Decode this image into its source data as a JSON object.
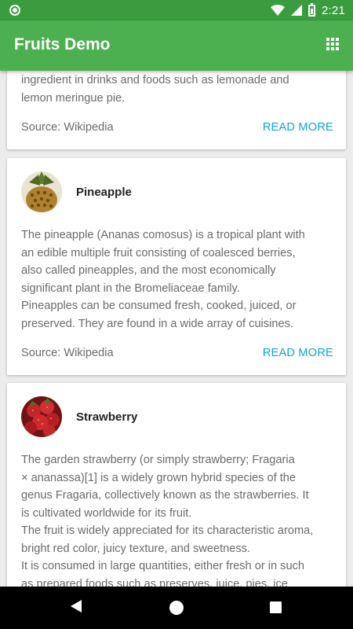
{
  "status_bar": {
    "time": "2:21"
  },
  "app_bar": {
    "title": "Fruits Demo"
  },
  "cards": [
    {
      "description_lines": [
        "ingredient in drinks and foods such as lemonade and",
        "lemon meringue pie."
      ],
      "source": "Source: Wikipedia",
      "read_more": "READ MORE"
    },
    {
      "name": "Pineapple",
      "description_lines": [
        "The pineapple (Ananas comosus) is a tropical plant with",
        "an edible multiple fruit consisting of coalesced berries,",
        "also called pineapples, and the most economically",
        "significant plant in the Bromeliaceae family.",
        "Pineapples can be consumed fresh, cooked, juiced, or",
        "preserved. They are found in a wide array of cuisines."
      ],
      "source": "Source: Wikipedia",
      "read_more": "READ MORE"
    },
    {
      "name": "Strawberry",
      "description_lines": [
        "The garden strawberry (or simply strawberry; Fragaria",
        "× ananassa)[1] is a widely grown hybrid species of the",
        "genus Fragaria, collectively known as the strawberries. It",
        "is cultivated worldwide for its fruit.",
        "The fruit is widely appreciated for its characteristic aroma,",
        "bright red color, juicy texture, and sweetness.",
        "It is consumed in large quantities, either fresh or in such",
        "as prepared foods such as preserves, juice, pies, ice"
      ]
    }
  ],
  "colors": {
    "status_bar": "#3a9c3f",
    "app_bar": "#4caf50",
    "accent": "#0ea5dc",
    "background": "#ececec"
  },
  "icons": {
    "app_bar_action": "grid-view-icon",
    "nav": [
      "back-icon",
      "home-icon",
      "recents-icon"
    ]
  }
}
